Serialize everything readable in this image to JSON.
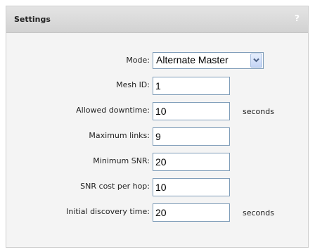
{
  "panel": {
    "title": "Settings",
    "help_icon": "?"
  },
  "fields": {
    "mode": {
      "label": "Mode:",
      "value": "Alternate Master",
      "icon": "chevron-down-icon"
    },
    "mesh_id": {
      "label": "Mesh ID:",
      "value": "1"
    },
    "allowed_downtime": {
      "label": "Allowed downtime:",
      "value": "10",
      "unit": "seconds"
    },
    "maximum_links": {
      "label": "Maximum links:",
      "value": "9"
    },
    "minimum_snr": {
      "label": "Minimum SNR:",
      "value": "20"
    },
    "snr_cost_per_hop": {
      "label": "SNR cost per hop:",
      "value": "10"
    },
    "initial_discovery_time": {
      "label": "Initial discovery time:",
      "value": "20",
      "unit": "seconds"
    }
  }
}
